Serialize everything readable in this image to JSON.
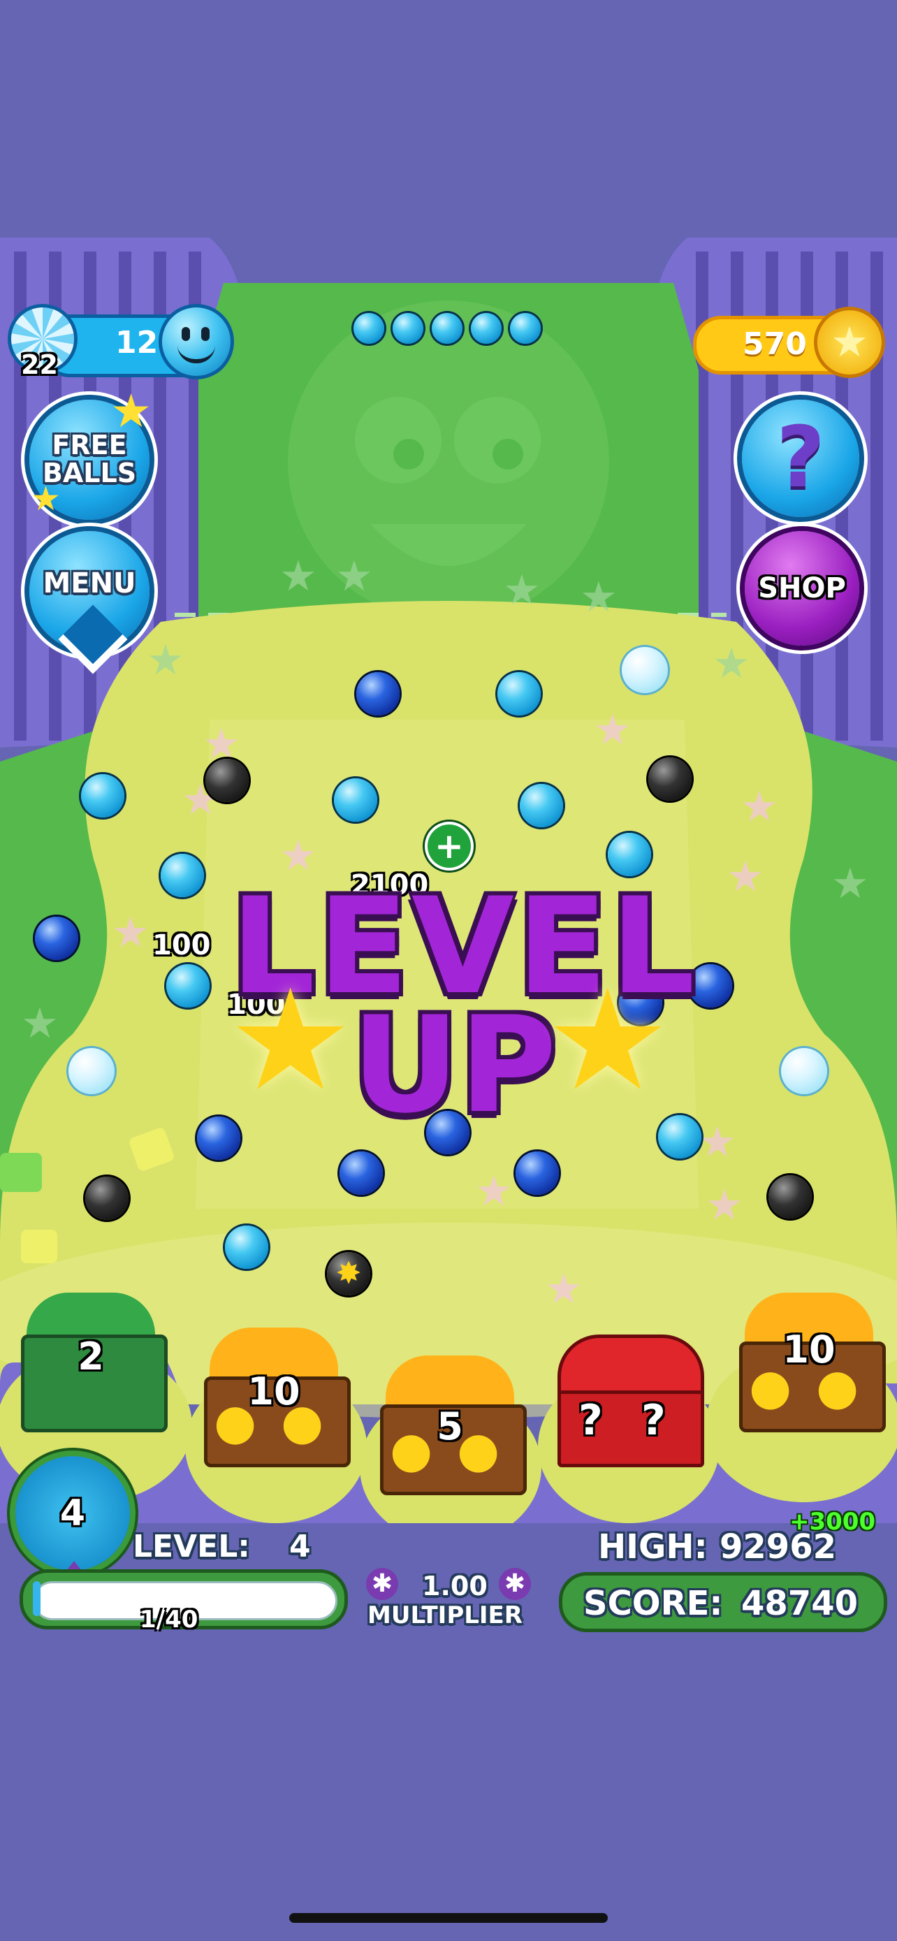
{
  "hud": {
    "balls_remaining": "12",
    "ball_bonus": "22",
    "coins": "570",
    "free_balls_label": "FREE\nBALLS",
    "menu_label": "MENU",
    "help_label": "?",
    "shop_label": "SHOP",
    "shots_indicator_count": 5
  },
  "overlay": {
    "level_up_line1": "LEVEL",
    "level_up_line2": "UP",
    "popup_scores": [
      "100",
      "100",
      "2100"
    ]
  },
  "buckets": [
    {
      "label": "2",
      "type": "green-puzzle"
    },
    {
      "label": "10",
      "type": "coin-chest"
    },
    {
      "label": "5",
      "type": "coin-chest"
    },
    {
      "label": "?",
      "type": "mystery-chest"
    },
    {
      "label": "10",
      "type": "coin-chest"
    }
  ],
  "footer": {
    "player_level_badge": "4",
    "level_label": "LEVEL:",
    "level_value": "4",
    "progress_text": "1/40",
    "progress_fraction": 0.025,
    "multiplier_value": "1.00",
    "multiplier_label": "MULTIPLIER",
    "high_label": "HIGH:",
    "high_value": "92962",
    "score_bonus": "+3000",
    "score_label": "SCORE:",
    "score_value": "48740"
  },
  "colors": {
    "background": "#6565b3",
    "board_green": "#56b94c",
    "board_yellow": "#d9e36a",
    "level_up_purple": "#9b1fd0",
    "coin_yellow": "#ffd21a"
  }
}
